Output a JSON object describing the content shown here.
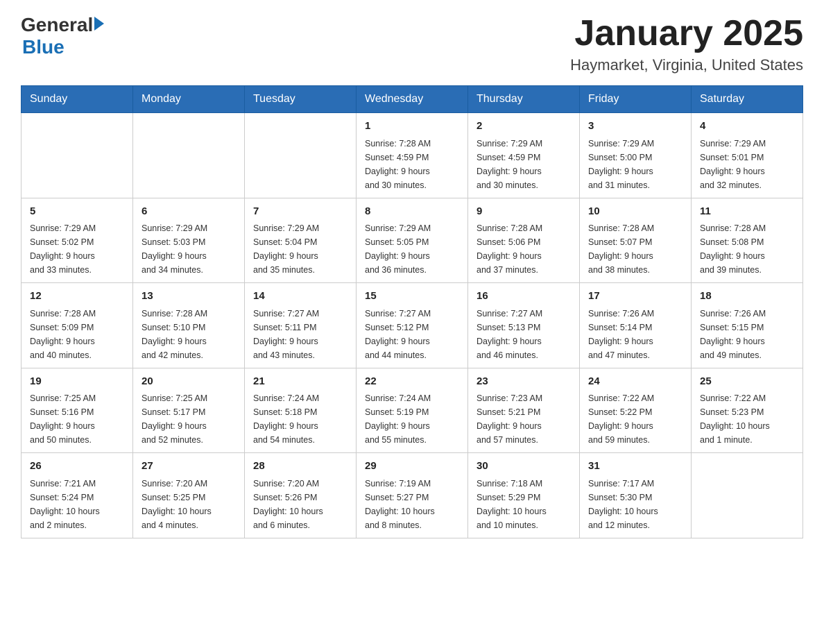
{
  "header": {
    "title": "January 2025",
    "location": "Haymarket, Virginia, United States"
  },
  "logo": {
    "general": "General",
    "blue": "Blue"
  },
  "days_of_week": [
    "Sunday",
    "Monday",
    "Tuesday",
    "Wednesday",
    "Thursday",
    "Friday",
    "Saturday"
  ],
  "weeks": [
    {
      "days": [
        {
          "date": "",
          "info": ""
        },
        {
          "date": "",
          "info": ""
        },
        {
          "date": "",
          "info": ""
        },
        {
          "date": "1",
          "info": "Sunrise: 7:28 AM\nSunset: 4:59 PM\nDaylight: 9 hours\nand 30 minutes."
        },
        {
          "date": "2",
          "info": "Sunrise: 7:29 AM\nSunset: 4:59 PM\nDaylight: 9 hours\nand 30 minutes."
        },
        {
          "date": "3",
          "info": "Sunrise: 7:29 AM\nSunset: 5:00 PM\nDaylight: 9 hours\nand 31 minutes."
        },
        {
          "date": "4",
          "info": "Sunrise: 7:29 AM\nSunset: 5:01 PM\nDaylight: 9 hours\nand 32 minutes."
        }
      ]
    },
    {
      "days": [
        {
          "date": "5",
          "info": "Sunrise: 7:29 AM\nSunset: 5:02 PM\nDaylight: 9 hours\nand 33 minutes."
        },
        {
          "date": "6",
          "info": "Sunrise: 7:29 AM\nSunset: 5:03 PM\nDaylight: 9 hours\nand 34 minutes."
        },
        {
          "date": "7",
          "info": "Sunrise: 7:29 AM\nSunset: 5:04 PM\nDaylight: 9 hours\nand 35 minutes."
        },
        {
          "date": "8",
          "info": "Sunrise: 7:29 AM\nSunset: 5:05 PM\nDaylight: 9 hours\nand 36 minutes."
        },
        {
          "date": "9",
          "info": "Sunrise: 7:28 AM\nSunset: 5:06 PM\nDaylight: 9 hours\nand 37 minutes."
        },
        {
          "date": "10",
          "info": "Sunrise: 7:28 AM\nSunset: 5:07 PM\nDaylight: 9 hours\nand 38 minutes."
        },
        {
          "date": "11",
          "info": "Sunrise: 7:28 AM\nSunset: 5:08 PM\nDaylight: 9 hours\nand 39 minutes."
        }
      ]
    },
    {
      "days": [
        {
          "date": "12",
          "info": "Sunrise: 7:28 AM\nSunset: 5:09 PM\nDaylight: 9 hours\nand 40 minutes."
        },
        {
          "date": "13",
          "info": "Sunrise: 7:28 AM\nSunset: 5:10 PM\nDaylight: 9 hours\nand 42 minutes."
        },
        {
          "date": "14",
          "info": "Sunrise: 7:27 AM\nSunset: 5:11 PM\nDaylight: 9 hours\nand 43 minutes."
        },
        {
          "date": "15",
          "info": "Sunrise: 7:27 AM\nSunset: 5:12 PM\nDaylight: 9 hours\nand 44 minutes."
        },
        {
          "date": "16",
          "info": "Sunrise: 7:27 AM\nSunset: 5:13 PM\nDaylight: 9 hours\nand 46 minutes."
        },
        {
          "date": "17",
          "info": "Sunrise: 7:26 AM\nSunset: 5:14 PM\nDaylight: 9 hours\nand 47 minutes."
        },
        {
          "date": "18",
          "info": "Sunrise: 7:26 AM\nSunset: 5:15 PM\nDaylight: 9 hours\nand 49 minutes."
        }
      ]
    },
    {
      "days": [
        {
          "date": "19",
          "info": "Sunrise: 7:25 AM\nSunset: 5:16 PM\nDaylight: 9 hours\nand 50 minutes."
        },
        {
          "date": "20",
          "info": "Sunrise: 7:25 AM\nSunset: 5:17 PM\nDaylight: 9 hours\nand 52 minutes."
        },
        {
          "date": "21",
          "info": "Sunrise: 7:24 AM\nSunset: 5:18 PM\nDaylight: 9 hours\nand 54 minutes."
        },
        {
          "date": "22",
          "info": "Sunrise: 7:24 AM\nSunset: 5:19 PM\nDaylight: 9 hours\nand 55 minutes."
        },
        {
          "date": "23",
          "info": "Sunrise: 7:23 AM\nSunset: 5:21 PM\nDaylight: 9 hours\nand 57 minutes."
        },
        {
          "date": "24",
          "info": "Sunrise: 7:22 AM\nSunset: 5:22 PM\nDaylight: 9 hours\nand 59 minutes."
        },
        {
          "date": "25",
          "info": "Sunrise: 7:22 AM\nSunset: 5:23 PM\nDaylight: 10 hours\nand 1 minute."
        }
      ]
    },
    {
      "days": [
        {
          "date": "26",
          "info": "Sunrise: 7:21 AM\nSunset: 5:24 PM\nDaylight: 10 hours\nand 2 minutes."
        },
        {
          "date": "27",
          "info": "Sunrise: 7:20 AM\nSunset: 5:25 PM\nDaylight: 10 hours\nand 4 minutes."
        },
        {
          "date": "28",
          "info": "Sunrise: 7:20 AM\nSunset: 5:26 PM\nDaylight: 10 hours\nand 6 minutes."
        },
        {
          "date": "29",
          "info": "Sunrise: 7:19 AM\nSunset: 5:27 PM\nDaylight: 10 hours\nand 8 minutes."
        },
        {
          "date": "30",
          "info": "Sunrise: 7:18 AM\nSunset: 5:29 PM\nDaylight: 10 hours\nand 10 minutes."
        },
        {
          "date": "31",
          "info": "Sunrise: 7:17 AM\nSunset: 5:30 PM\nDaylight: 10 hours\nand 12 minutes."
        },
        {
          "date": "",
          "info": ""
        }
      ]
    }
  ]
}
